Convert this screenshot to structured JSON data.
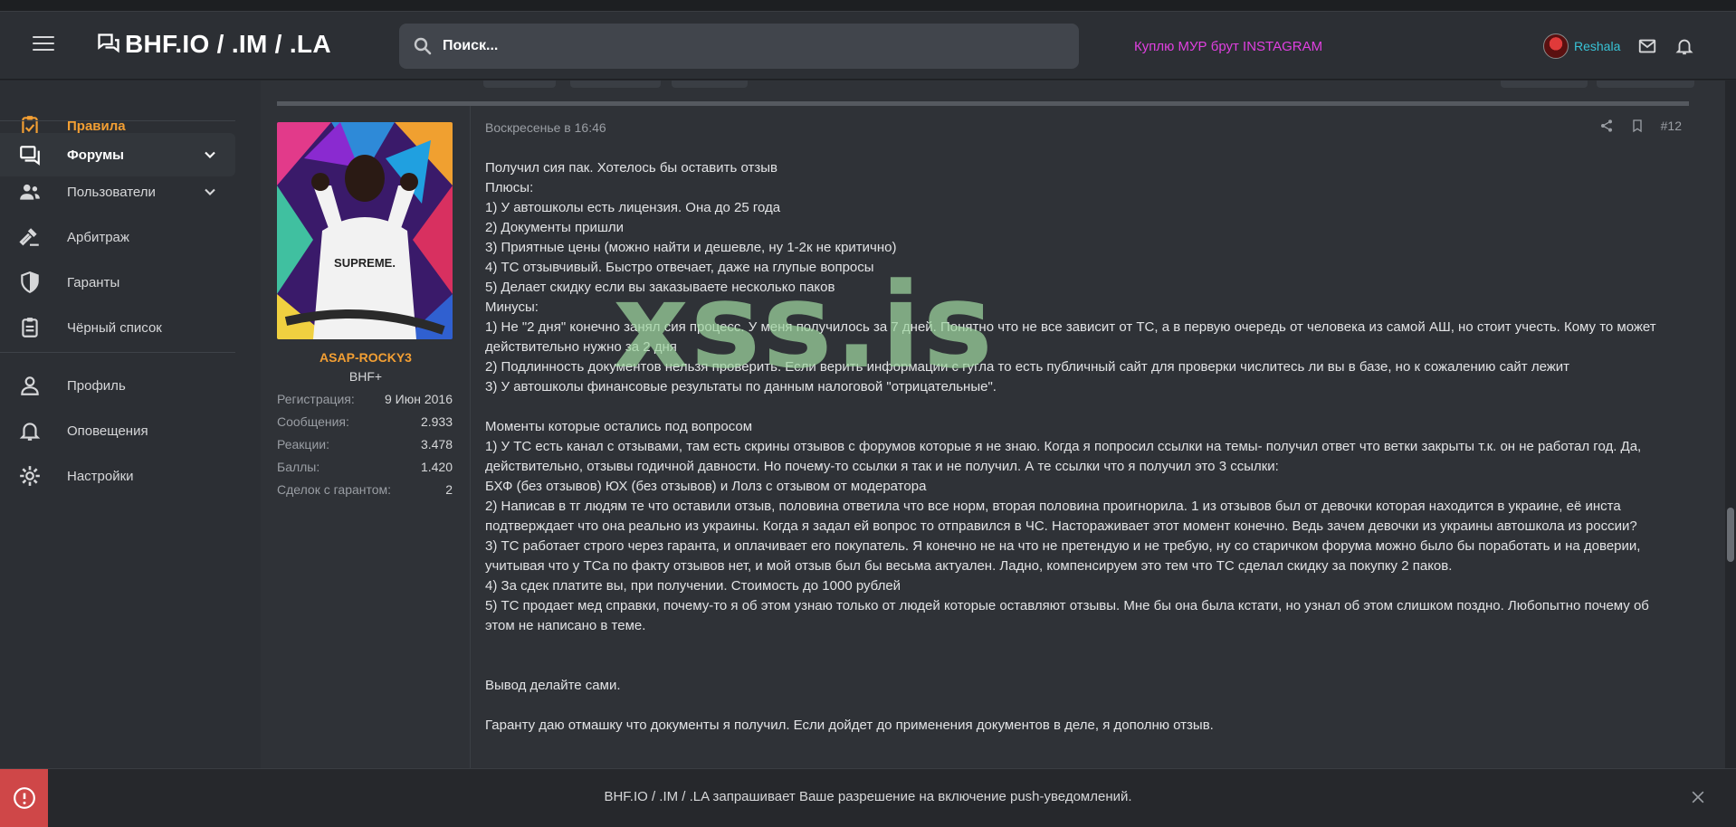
{
  "header": {
    "logo_text": "BHF.IO / .IM / .LA",
    "search_placeholder": "Поиск...",
    "ad_link": "Куплю МУР брут INSTAGRAM",
    "username": "Reshala"
  },
  "sidebar": {
    "items": [
      {
        "label": "Правила",
        "icon": "clipboard-icon"
      },
      {
        "label": "Форумы",
        "icon": "forum-icon"
      },
      {
        "label": "Пользователи",
        "icon": "users-icon"
      },
      {
        "label": "Арбитраж",
        "icon": "gavel-icon"
      },
      {
        "label": "Гаранты",
        "icon": "shield-icon"
      },
      {
        "label": "Чёрный список",
        "icon": "blacklist-icon"
      },
      {
        "label": "Профиль",
        "icon": "person-icon"
      },
      {
        "label": "Оповещения",
        "icon": "bell-icon"
      },
      {
        "label": "Настройки",
        "icon": "gear-icon"
      }
    ]
  },
  "author": {
    "name": "ASAP-ROCKY3",
    "title": "BHF+",
    "avatar_text": "SUPREME.",
    "stats": [
      {
        "key": "Регистрация:",
        "value": "9 Июн 2016"
      },
      {
        "key": "Сообщения:",
        "value": "2.933"
      },
      {
        "key": "Реакции:",
        "value": "3.478"
      },
      {
        "key": "Баллы:",
        "value": "1.420"
      },
      {
        "key": "Сделок с гарантом:",
        "value": "2"
      }
    ]
  },
  "post": {
    "date": "Воскресенье в 16:46",
    "number": "#12",
    "lines": [
      "Получил сия пак. Хотелось бы оставить отзыв",
      "Плюсы:",
      "1) У автошколы есть лицензия. Она до 25 года",
      "2) Документы пришли",
      "3) Приятные цены (можно найти и дешевле, ну 1-2к не критично)",
      "4) ТС отзывчивый. Быстро отвечает, даже на глупые вопросы",
      "5) Делает скидку если вы заказываете несколько паков",
      "Минусы:",
      "1) Не \"2 дня\" конечно занял сия процесс. У меня получилось за 7 дней. Понятно что не все зависит от ТС, а в первую очередь от человека из самой АШ, но стоит учесть. Кому то может действительно нужно за 2 дня",
      "2) Подлинность документов нельзя проверить. Если верить информации с гугла то есть публичный сайт для проверки числитесь ли вы в базе, но к сожалению сайт лежит",
      "3) У автошколы финансовые результаты по данным налоговой \"отрицательные\".",
      "",
      "Моменты которые остались под вопросом",
      "1) У ТС есть канал с отзывами, там есть скрины отзывов с форумов которые я не знаю. Когда я попросил ссылки на темы- получил ответ что ветки закрыты т.к. он не работал год. Да, действительно, отзывы годичной давности. Но почему-то ссылки я так и не получил. А те ссылки что я получил это 3 ссылки:",
      "БХФ (без отзывов) ЮХ (без отзывов) и Лолз с отзывом от модератора",
      "2) Написав в тг людям те что оставили отзыв, половина ответила что все норм, вторая половина проигнорила. 1 из отзывов был от девочки которая находится в украине, её инста подтверждает что она реально из украины. Когда я задал ей вопрос то отправился в ЧС. Настораживает этот момент конечно. Ведь зачем девочки из украины автошкола из россии?",
      "3) ТС работает строго через гаранта, и оплачивает его покупатель. Я конечно не на что не претендую и не требую, ну со старичком форума можно было бы поработать и на доверии, учитывая что у ТСа по факту отзывов нет, и мой отзыв был бы весьма актуален. Ладно, компенсируем это тем что ТС сделал скидку за покупку 2 паков.",
      "4) За сдек платите вы, при получении. Стоимость до 1000 рублей",
      "5) ТС продает мед справки, почему-то я об этом узнаю только от людей которые оставляют отзывы. Мне бы она была кстати, но узнал об этом слишком поздно. Любопытно почему об этом не написано в теме.",
      "",
      "",
      "Вывод делайте сами.",
      "",
      "Гаранту даю отмашку что документы я получил. Если дойдет до применения документов в деле, я дополню отзыв."
    ]
  },
  "watermark": "xss.is",
  "notice": {
    "text": "BHF.IO / .IM / .LA запрашивает Ваше разрешение на ",
    "link": "включение push-уведомлений."
  },
  "colors": {
    "accent": "#f39f33",
    "username": "#38c3d6",
    "ad": "#e040e0",
    "notice_icon_bg": "#cf4748"
  }
}
